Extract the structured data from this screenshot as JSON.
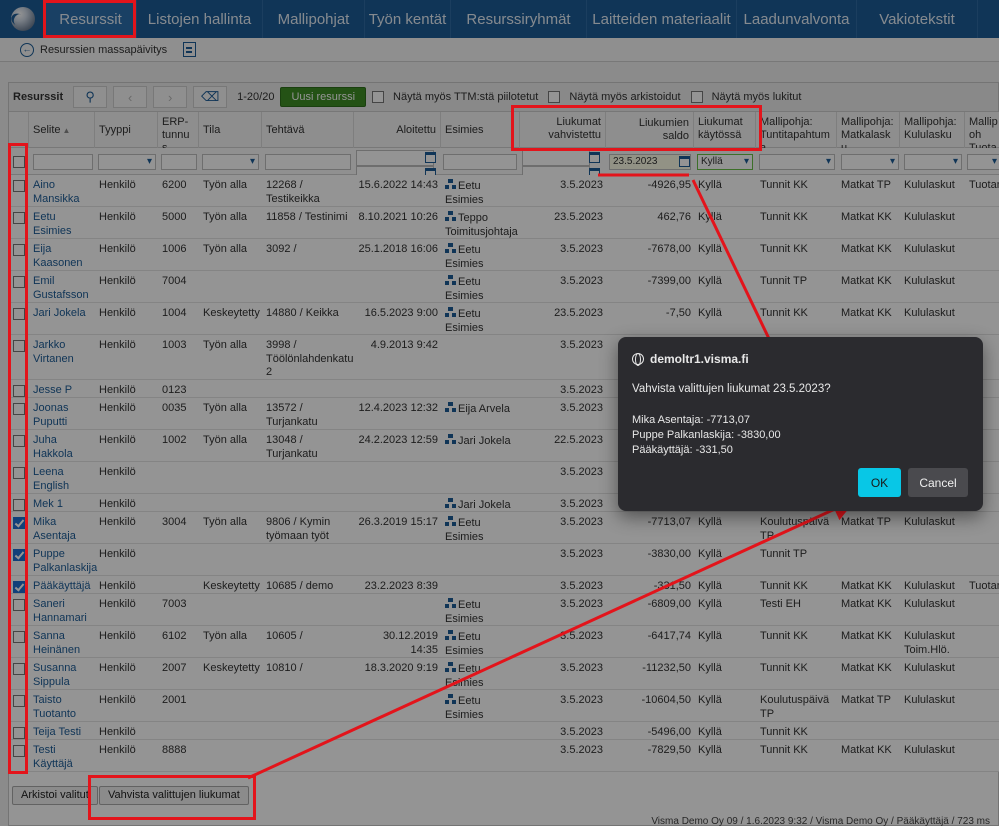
{
  "nav": {
    "tabs": [
      "Resurssit",
      "Listojen hallinta",
      "Mallipohjat",
      "Työn kentät",
      "Resurssiryhmät",
      "Laitteiden materiaalit",
      "Laadunvalvonta",
      "Vakiotekstit"
    ]
  },
  "subbar": {
    "label": "Resurssien massapäivitys"
  },
  "toolbar": {
    "title": "Resurssit",
    "count": "1-20/20",
    "new_button": "Uusi resurssi",
    "checkboxes": [
      "Näytä myös TTM:stä piilotetut",
      "Näytä myös arkistoidut",
      "Näytä myös lukitut"
    ]
  },
  "columns": [
    "Selite",
    "Tyyppi",
    "ERP-tunnus",
    "Tila",
    "Tehtävä",
    "Aloitettu",
    "Esimies",
    "Liukumat vahvistettu",
    "Liukumien saldo",
    "Liukumat käytössä",
    "Mallipohja: Tuntitapahtuma",
    "Mallipohja: Matkalasku",
    "Mallipohja: Kululasku",
    "Mallipoh Tuotan"
  ],
  "filters": {
    "date_value": "23.5.2023",
    "kaytossa_value": "Kyllä"
  },
  "rows": [
    {
      "selite": "Aino Mansikka",
      "tyyppi": "Henkilö",
      "erp": "6200",
      "tila": "Työn alla",
      "tehtava": "12268 / Testikeikka",
      "aloitettu": "15.6.2022 14:43",
      "esimies": "Eetu Esimies",
      "vahvistettu": "3.5.2023",
      "saldo": "-4926,95",
      "kaytossa": "Kyllä",
      "tunti": "Tunnit KK",
      "matka": "Matkat TP",
      "kulu": "Kululaskut",
      "tuotan": "Tuotan",
      "checked": false
    },
    {
      "selite": "Eetu Esimies",
      "tyyppi": "Henkilö",
      "erp": "5000",
      "tila": "Työn alla",
      "tehtava": "11858 / Testinimi",
      "aloitettu": "8.10.2021 10:26",
      "esimies": "Teppo Toimitusjohtaja",
      "vahvistettu": "23.5.2023",
      "saldo": "462,76",
      "kaytossa": "Kyllä",
      "tunti": "Tunnit KK",
      "matka": "Matkat KK",
      "kulu": "Kululaskut",
      "tuotan": "",
      "checked": false
    },
    {
      "selite": "Eija Kaasonen",
      "tyyppi": "Henkilö",
      "erp": "1006",
      "tila": "Työn alla",
      "tehtava": "3092 /",
      "aloitettu": "25.1.2018 16:06",
      "esimies": "Eetu Esimies",
      "vahvistettu": "3.5.2023",
      "saldo": "-7678,00",
      "kaytossa": "Kyllä",
      "tunti": "Tunnit KK",
      "matka": "Matkat KK",
      "kulu": "Kululaskut",
      "tuotan": "",
      "checked": false
    },
    {
      "selite": "Emil Gustafsson",
      "tyyppi": "Henkilö",
      "erp": "7004",
      "tila": "",
      "tehtava": "",
      "aloitettu": "",
      "esimies": "Eetu Esimies",
      "vahvistettu": "3.5.2023",
      "saldo": "-7399,00",
      "kaytossa": "Kyllä",
      "tunti": "Tunnit TP",
      "matka": "Matkat KK",
      "kulu": "Kululaskut",
      "tuotan": "",
      "checked": false
    },
    {
      "selite": "Jari Jokela",
      "tyyppi": "Henkilö",
      "erp": "1004",
      "tila": "Keskeytetty",
      "tehtava": "14880 / Keikka",
      "aloitettu": "16.5.2023 9:00",
      "esimies": "Eetu Esimies",
      "vahvistettu": "23.5.2023",
      "saldo": "-7,50",
      "kaytossa": "Kyllä",
      "tunti": "Tunnit KK",
      "matka": "Matkat KK",
      "kulu": "Kululaskut",
      "tuotan": "",
      "checked": false
    },
    {
      "selite": "Jarkko Virtanen",
      "tyyppi": "Henkilö",
      "erp": "1003",
      "tila": "Työn alla",
      "tehtava": "3998 / Töölönlahdenkatu 2",
      "aloitettu": "4.9.2013 9:42",
      "esimies": "",
      "vahvistettu": "3.5.2023",
      "saldo": "",
      "kaytossa": "",
      "tunti": "",
      "matka": "",
      "kulu": "",
      "tuotan": "",
      "checked": false
    },
    {
      "selite": "Jesse P",
      "tyyppi": "Henkilö",
      "erp": "0123",
      "tila": "",
      "tehtava": "",
      "aloitettu": "",
      "esimies": "",
      "vahvistettu": "3.5.2023",
      "saldo": "",
      "kaytossa": "",
      "tunti": "",
      "matka": "",
      "kulu": "",
      "tuotan": "",
      "checked": false
    },
    {
      "selite": "Joonas Puputti",
      "tyyppi": "Henkilö",
      "erp": "0035",
      "tila": "Työn alla",
      "tehtava": "13572 / Turjankatu",
      "aloitettu": "12.4.2023 12:32",
      "esimies": "Eija Arvela",
      "vahvistettu": "3.5.2023",
      "saldo": "",
      "kaytossa": "",
      "tunti": "",
      "matka": "",
      "kulu": "",
      "tuotan": "",
      "checked": false
    },
    {
      "selite": "Juha Hakkola",
      "tyyppi": "Henkilö",
      "erp": "1002",
      "tila": "Työn alla",
      "tehtava": "13048 / Turjankatu",
      "aloitettu": "24.2.2023 12:59",
      "esimies": "Jari Jokela",
      "vahvistettu": "22.5.2023",
      "saldo": "",
      "kaytossa": "",
      "tunti": "",
      "matka": "",
      "kulu": "",
      "tuotan": "",
      "checked": false
    },
    {
      "selite": "Leena English",
      "tyyppi": "Henkilö",
      "erp": "",
      "tila": "",
      "tehtava": "",
      "aloitettu": "",
      "esimies": "",
      "vahvistettu": "3.5.2023",
      "saldo": "",
      "kaytossa": "",
      "tunti": "",
      "matka": "",
      "kulu": "",
      "tuotan": "",
      "checked": false
    },
    {
      "selite": "Mek 1",
      "tyyppi": "Henkilö",
      "erp": "",
      "tila": "",
      "tehtava": "",
      "aloitettu": "",
      "esimies": "Jari Jokela",
      "vahvistettu": "3.5.2023",
      "saldo": "",
      "kaytossa": "",
      "tunti": "",
      "matka": "",
      "kulu": "",
      "tuotan": "",
      "checked": false
    },
    {
      "selite": "Mika Asentaja",
      "tyyppi": "Henkilö",
      "erp": "3004",
      "tila": "Työn alla",
      "tehtava": "9806 / Kymin työmaan työt",
      "aloitettu": "26.3.2019 15:17",
      "esimies": "Eetu Esimies",
      "vahvistettu": "3.5.2023",
      "saldo": "-7713,07",
      "kaytossa": "Kyllä",
      "tunti": "Koulutuspäivä TP",
      "matka": "Matkat TP",
      "kulu": "Kululaskut",
      "tuotan": "",
      "checked": true
    },
    {
      "selite": "Puppe Palkanlaskija",
      "tyyppi": "Henkilö",
      "erp": "",
      "tila": "",
      "tehtava": "",
      "aloitettu": "",
      "esimies": "",
      "vahvistettu": "3.5.2023",
      "saldo": "-3830,00",
      "kaytossa": "Kyllä",
      "tunti": "Tunnit TP",
      "matka": "",
      "kulu": "",
      "tuotan": "",
      "checked": true
    },
    {
      "selite": "Pääkäyttäjä",
      "tyyppi": "Henkilö",
      "erp": "",
      "tila": "Keskeytetty",
      "tehtava": "10685 / demo",
      "aloitettu": "23.2.2023 8:39",
      "esimies": "",
      "vahvistettu": "3.5.2023",
      "saldo": "-331,50",
      "kaytossa": "Kyllä",
      "tunti": "Tunnit KK",
      "matka": "Matkat KK",
      "kulu": "Kululaskut",
      "tuotan": "Tuotan",
      "checked": true
    },
    {
      "selite": "Saneri Hannamari",
      "tyyppi": "Henkilö",
      "erp": "7003",
      "tila": "",
      "tehtava": "",
      "aloitettu": "",
      "esimies": "Eetu Esimies",
      "vahvistettu": "3.5.2023",
      "saldo": "-6809,00",
      "kaytossa": "Kyllä",
      "tunti": "Testi EH",
      "matka": "Matkat KK",
      "kulu": "Kululaskut",
      "tuotan": "",
      "checked": false
    },
    {
      "selite": "Sanna Heinänen",
      "tyyppi": "Henkilö",
      "erp": "6102",
      "tila": "Työn alla",
      "tehtava": "10605 /",
      "aloitettu": "30.12.2019 14:35",
      "esimies": "Eetu Esimies",
      "vahvistettu": "3.5.2023",
      "saldo": "-6417,74",
      "kaytossa": "Kyllä",
      "tunti": "Tunnit KK",
      "matka": "Matkat KK",
      "kulu": "Kululaskut Toim.Hlö.",
      "tuotan": "",
      "checked": false
    },
    {
      "selite": "Susanna Sippula",
      "tyyppi": "Henkilö",
      "erp": "2007",
      "tila": "Keskeytetty",
      "tehtava": "10810 /",
      "aloitettu": "18.3.2020 9:19",
      "esimies": "Eetu Esimies",
      "vahvistettu": "3.5.2023",
      "saldo": "-11232,50",
      "kaytossa": "Kyllä",
      "tunti": "Tunnit KK",
      "matka": "Matkat KK",
      "kulu": "Kululaskut",
      "tuotan": "",
      "checked": false
    },
    {
      "selite": "Taisto Tuotanto",
      "tyyppi": "Henkilö",
      "erp": "2001",
      "tila": "",
      "tehtava": "",
      "aloitettu": "",
      "esimies": "Eetu Esimies",
      "vahvistettu": "3.5.2023",
      "saldo": "-10604,50",
      "kaytossa": "Kyllä",
      "tunti": "Koulutuspäivä TP",
      "matka": "Matkat TP",
      "kulu": "Kululaskut",
      "tuotan": "",
      "checked": false
    },
    {
      "selite": "Teija Testi",
      "tyyppi": "Henkilö",
      "erp": "",
      "tila": "",
      "tehtava": "",
      "aloitettu": "",
      "esimies": "",
      "vahvistettu": "3.5.2023",
      "saldo": "-5496,00",
      "kaytossa": "Kyllä",
      "tunti": "Tunnit KK",
      "matka": "",
      "kulu": "",
      "tuotan": "",
      "checked": false
    },
    {
      "selite": "Testi Käyttäjä",
      "tyyppi": "Henkilö",
      "erp": "8888",
      "tila": "",
      "tehtava": "",
      "aloitettu": "",
      "esimies": "",
      "vahvistettu": "3.5.2023",
      "saldo": "-7829,50",
      "kaytossa": "Kyllä",
      "tunti": "Tunnit KK",
      "matka": "Matkat KK",
      "kulu": "Kululaskut",
      "tuotan": "",
      "checked": false
    }
  ],
  "bottom": {
    "archive_button": "Arkistoi valitut",
    "confirm_button": "Vahvista valittujen liukumat",
    "footer": "Visma Demo Oy 09 / 1.6.2023 9:32 / Visma Demo Oy / Pääkäyttäjä / 723 ms"
  },
  "dialog": {
    "origin": "demoltr1.visma.fi",
    "question": "Vahvista valittujen liukumat 23.5.2023?",
    "entries": [
      "Mika Asentaja: -7713,07",
      "Puppe Palkanlaskija: -3830,00",
      "Pääkäyttäjä: -331,50"
    ],
    "ok": "OK",
    "cancel": "Cancel"
  },
  "colors": {
    "nav": "#1d5c96",
    "link": "#1d5c96",
    "new_button": "#3e8d25",
    "annotation": "#e3141b",
    "ok_button": "#08c7e6"
  }
}
